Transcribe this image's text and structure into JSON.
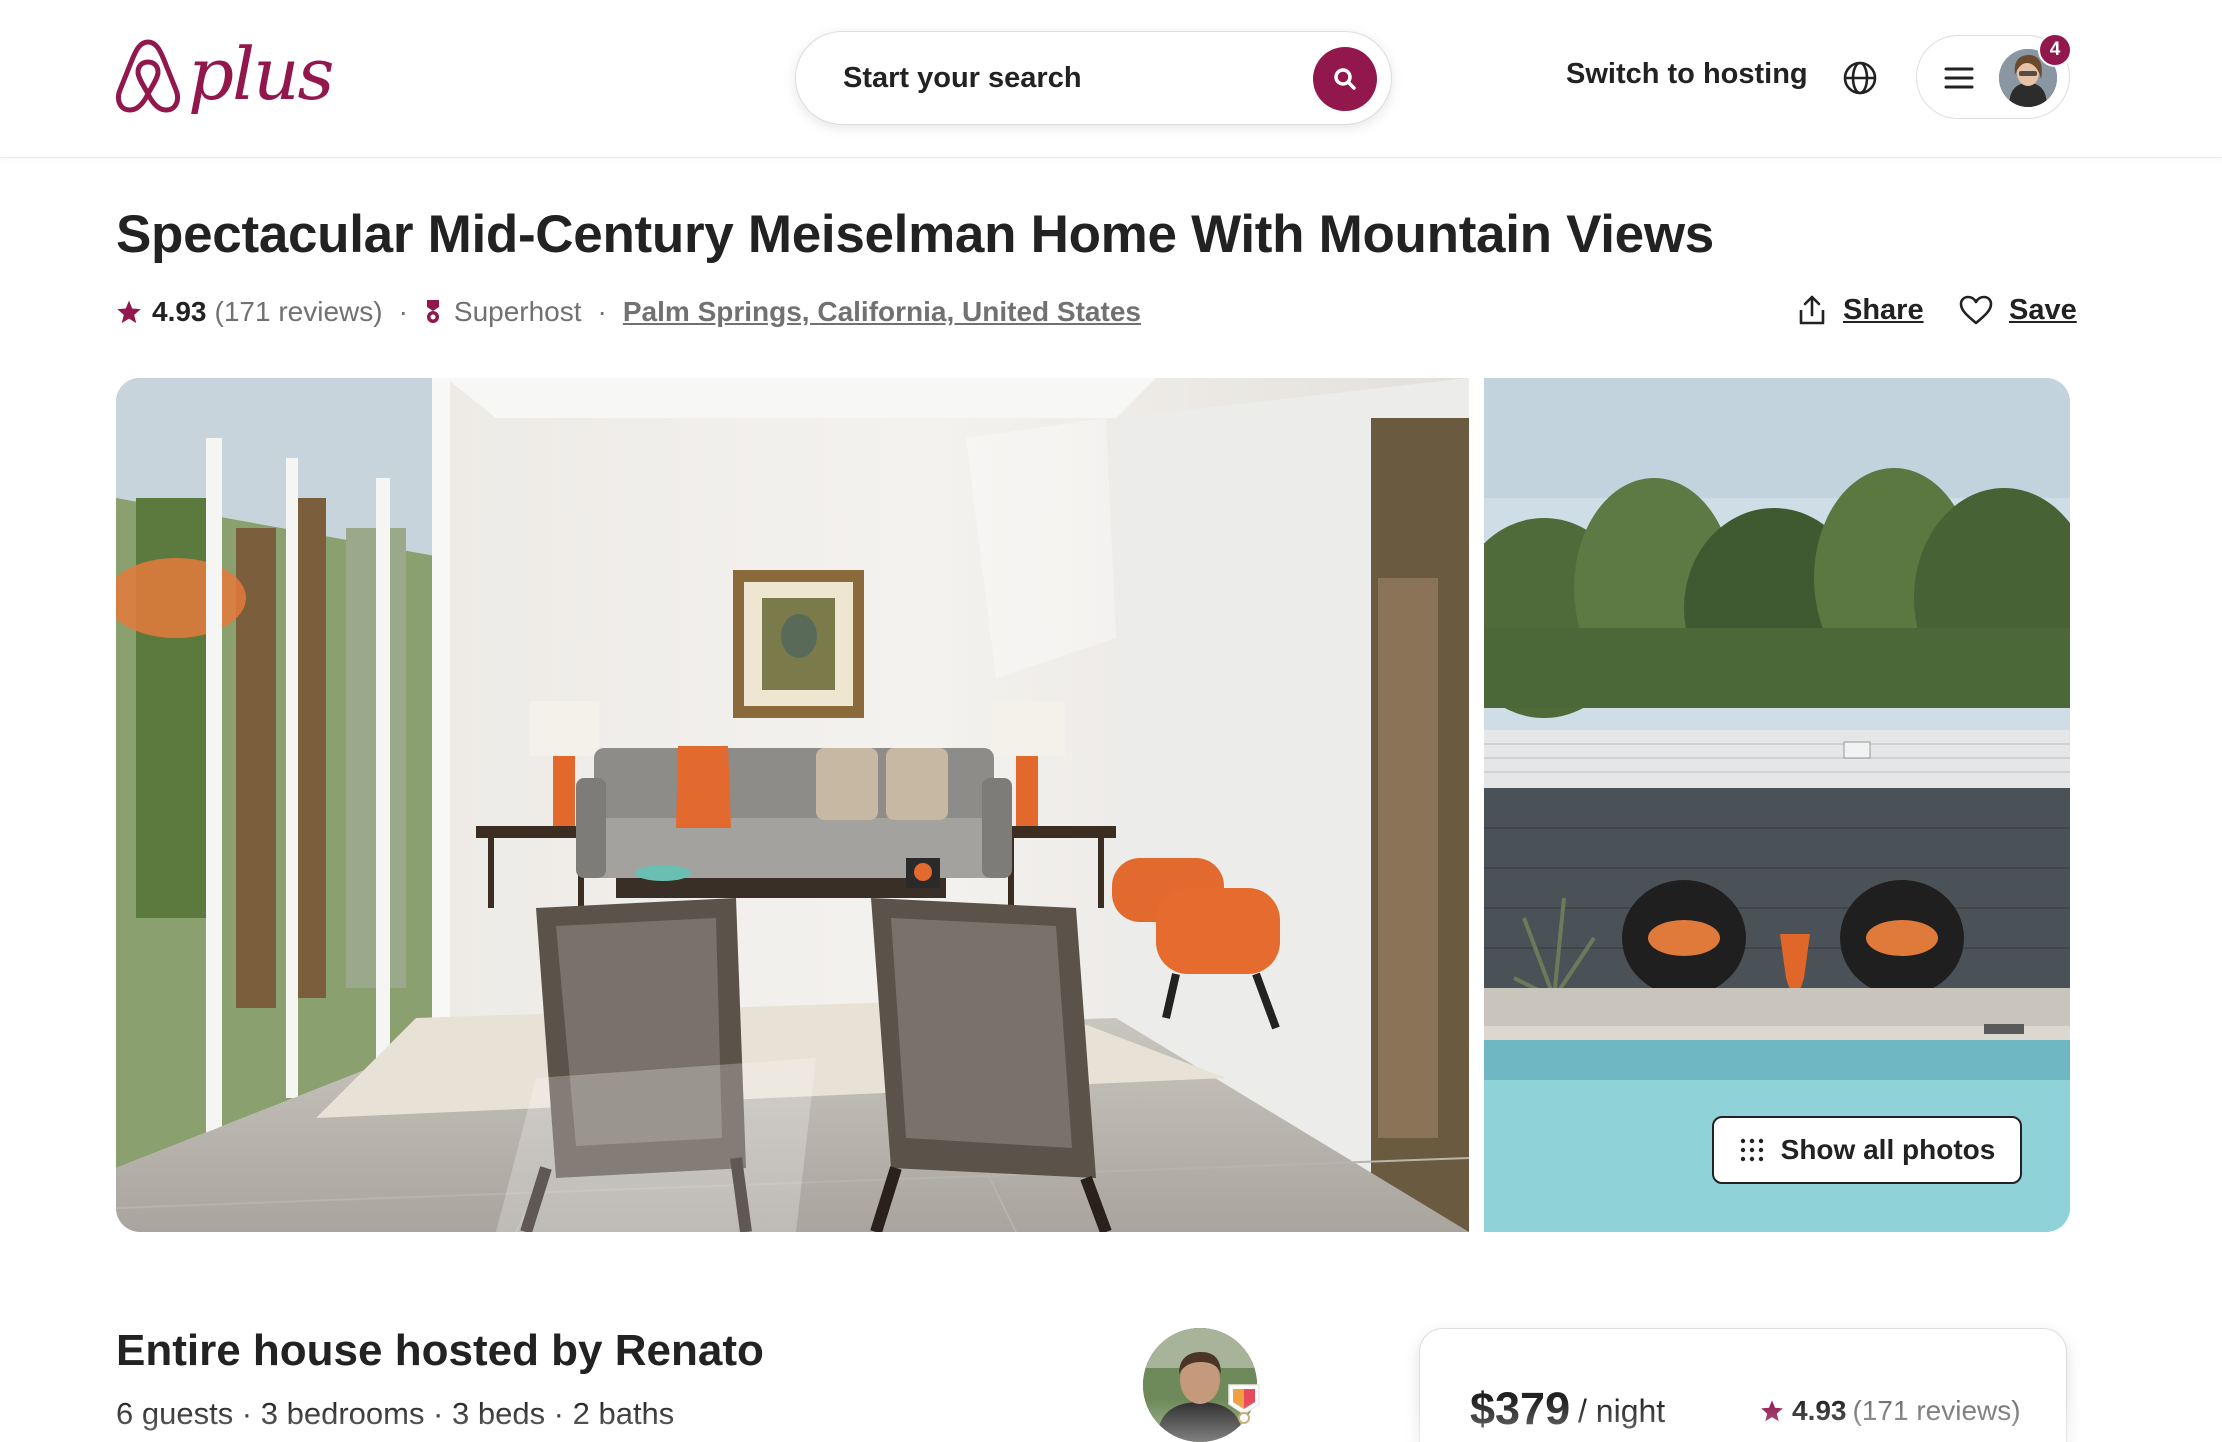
{
  "header": {
    "logo_text": "plus",
    "search_label": "Start your search",
    "switch_to_hosting": "Switch to hosting",
    "notification_count": "4"
  },
  "listing": {
    "title": "Spectacular Mid-Century Meiselman Home With Mountain Views",
    "rating": "4.93",
    "reviews": "(171 reviews)",
    "superhost": "Superhost",
    "location": "Palm Springs, California, United States",
    "separator": "·",
    "share_label": "Share",
    "save_label": "Save"
  },
  "gallery": {
    "show_all_label": "Show all photos"
  },
  "host": {
    "heading": "Entire house hosted by Renato",
    "details": "6 guests · 3 bedrooms · 3 beds · 2 baths"
  },
  "booking": {
    "price": "$379",
    "per_night": "/ night",
    "rating": "4.93",
    "reviews": "(171 reviews)"
  },
  "colors": {
    "brand": "#92174d",
    "text": "#222222",
    "muted": "#717171"
  },
  "icons": [
    "airbnb-logo-icon",
    "search-icon",
    "globe-icon",
    "hamburger-icon",
    "star-icon",
    "superhost-icon",
    "share-icon",
    "heart-icon",
    "photo-grid-icon",
    "host-badge-icon"
  ]
}
